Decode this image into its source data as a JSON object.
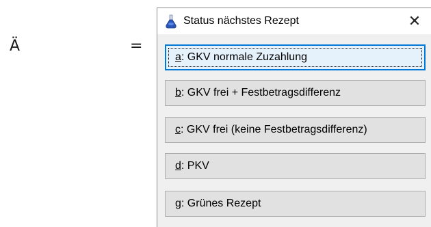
{
  "background_chars": {
    "key": "Ä",
    "equals": "="
  },
  "dialog": {
    "title": "Status nächstes Rezept",
    "close_glyph": "✕",
    "title_icon": "flask-icon",
    "buttons": [
      {
        "accel": "a",
        "rest": ": GKV normale Zuzahlung",
        "default": true
      },
      {
        "accel": "b",
        "rest": ": GKV frei + Festbetragsdifferenz",
        "default": false
      },
      {
        "accel": "c",
        "rest": ": GKV frei (keine Festbetragsdifferenz)",
        "default": false
      },
      {
        "accel": "d",
        "rest": ": PKV",
        "default": false
      },
      {
        "accel": "g",
        "rest": ": Grünes Rezept",
        "default": false
      }
    ]
  },
  "colors": {
    "accent": "#0078d7",
    "button_face": "#e1e1e1",
    "dialog_bg": "#f0f0f0"
  }
}
